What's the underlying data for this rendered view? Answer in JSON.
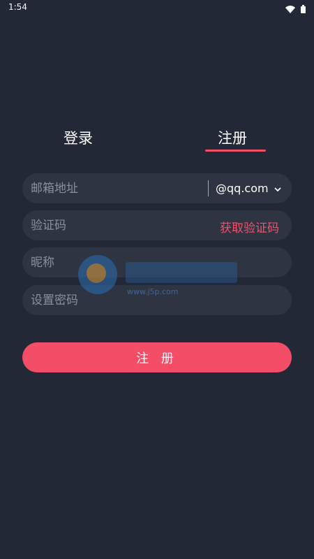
{
  "status_bar": {
    "time": "1:54",
    "icons": [
      "wifi-icon",
      "battery-icon"
    ]
  },
  "tabs": [
    {
      "label": "登录",
      "active": false
    },
    {
      "label": "注册",
      "active": true
    }
  ],
  "form": {
    "email": {
      "placeholder": "邮箱地址",
      "value": "",
      "domain": "@qq.com"
    },
    "code": {
      "placeholder": "验证码",
      "value": "",
      "action_label": "获取验证码"
    },
    "nickname": {
      "placeholder": "昵称",
      "value": ""
    },
    "password": {
      "placeholder": "设置密码",
      "value": ""
    },
    "submit_label": "注 册"
  },
  "watermark": {
    "site": "www.j5p.com"
  },
  "colors": {
    "background": "#232836",
    "field_bg": "#2f3443",
    "accent": "#f44d68",
    "placeholder": "#8a8f9c"
  }
}
